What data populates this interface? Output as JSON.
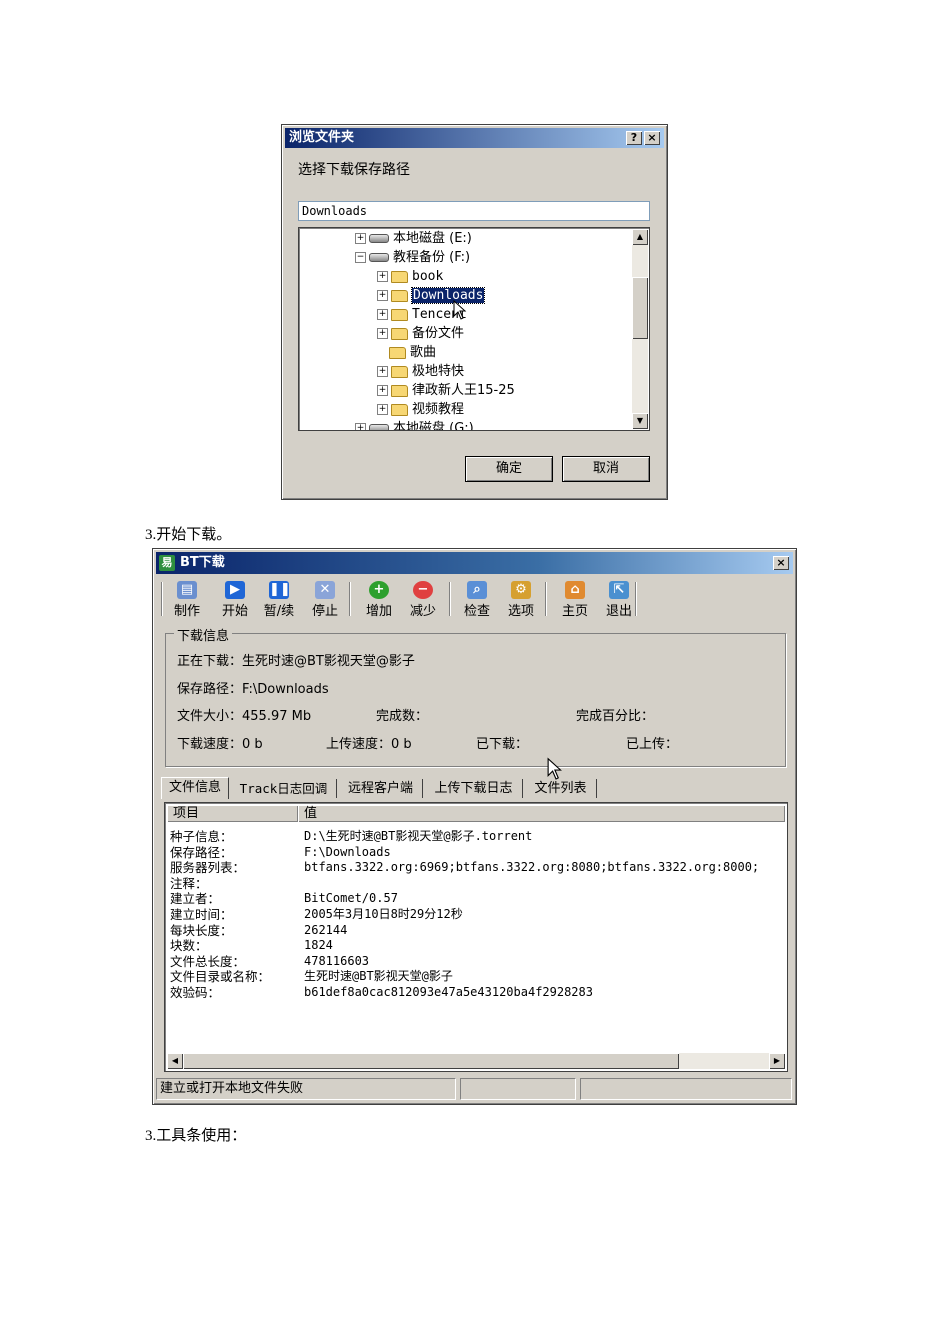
{
  "browse_dialog": {
    "title": "浏览文件夹",
    "help_button": "?",
    "close_button": "×",
    "prompt": "选择下载保存路径",
    "path_value": "Downloads",
    "tree": [
      {
        "label": "本地磁盘 (E:)",
        "expander": "+",
        "kind": "drive"
      },
      {
        "label": "教程备份 (F:)",
        "expander": "−",
        "kind": "drive"
      },
      {
        "label": "book",
        "expander": "+",
        "kind": "folder"
      },
      {
        "label": "Downloads",
        "expander": "+",
        "kind": "folder",
        "selected": true
      },
      {
        "label": "Tencent",
        "expander": "+",
        "kind": "folder"
      },
      {
        "label": "备份文件",
        "expander": "+",
        "kind": "folder"
      },
      {
        "label": "歌曲",
        "expander": "",
        "kind": "folder"
      },
      {
        "label": "极地特快",
        "expander": "+",
        "kind": "folder"
      },
      {
        "label": "律政新人王15-25",
        "expander": "+",
        "kind": "folder"
      },
      {
        "label": "视频教程",
        "expander": "+",
        "kind": "folder"
      },
      {
        "label": "本地磁盘 (G:)",
        "expander": "+",
        "kind": "drive"
      }
    ],
    "ok_button": "确定",
    "cancel_button": "取消"
  },
  "captions": {
    "start_download": "3.开始下载。",
    "toolbar_usage": "3.工具条使用："
  },
  "bt_window": {
    "title": "BT下载",
    "logo": "易",
    "close_button": "×",
    "toolbar": [
      {
        "label": "制作",
        "icon": "make-icon",
        "color": "#6a8fcf"
      },
      {
        "label": "开始",
        "icon": "play-icon",
        "color": "#1f66d6"
      },
      {
        "label": "暂/续",
        "icon": "pause-icon",
        "color": "#1f66d6"
      },
      {
        "label": "停止",
        "icon": "stop-icon",
        "color": "#8aa4d8"
      },
      {
        "label": "增加",
        "icon": "plus-icon",
        "color": "#2ea02e"
      },
      {
        "label": "减少",
        "icon": "minus-icon",
        "color": "#e04040"
      },
      {
        "label": "检查",
        "icon": "magnifier-icon",
        "color": "#5a8fd6"
      },
      {
        "label": "选项",
        "icon": "options-icon",
        "color": "#d6a030"
      },
      {
        "label": "主页",
        "icon": "home-icon",
        "color": "#e08a30"
      },
      {
        "label": "退出",
        "icon": "exit-icon",
        "color": "#4a90d0"
      }
    ],
    "info": {
      "group_title": "下载信息",
      "downloading": "正在下载：生死时速@BT影视天堂@影子",
      "save_path": "保存路径：F:\\Downloads",
      "file_size": "文件大小：455.97 Mb",
      "completed_count": "完成数：",
      "completed_percent": "完成百分比：",
      "download_speed": "下载速度：0 b",
      "upload_speed": "上传速度：0 b",
      "downloaded": "已下载：",
      "uploaded": "已上传："
    },
    "tabs": [
      "文件信息",
      "Track日志回调",
      "远程客户端",
      "上传下载日志",
      "文件列表"
    ],
    "list": {
      "col_item": "项目",
      "col_value": "值",
      "rows": [
        {
          "key": "种子信息：",
          "value": "D:\\生死时速@BT影视天堂@影子.torrent"
        },
        {
          "key": "保存路径：",
          "value": "F:\\Downloads"
        },
        {
          "key": "服务器列表：",
          "value": "btfans.3322.org:6969;btfans.3322.org:8080;btfans.3322.org:8000;"
        },
        {
          "key": "注释：",
          "value": ""
        },
        {
          "key": "建立者：",
          "value": "BitComet/0.57"
        },
        {
          "key": "建立时间：",
          "value": "2005年3月10日8时29分12秒"
        },
        {
          "key": "每块长度：",
          "value": "262144"
        },
        {
          "key": "块数：",
          "value": "1824"
        },
        {
          "key": "文件总长度：",
          "value": "478116603"
        },
        {
          "key": "文件目录或名称：",
          "value": "生死时速@BT影视天堂@影子"
        },
        {
          "key": "效验码：",
          "value": "b61def8a0cac812093e47a5e43120ba4f2928283"
        }
      ]
    },
    "status": [
      "建立或打开本地文件失败",
      "",
      ""
    ]
  }
}
